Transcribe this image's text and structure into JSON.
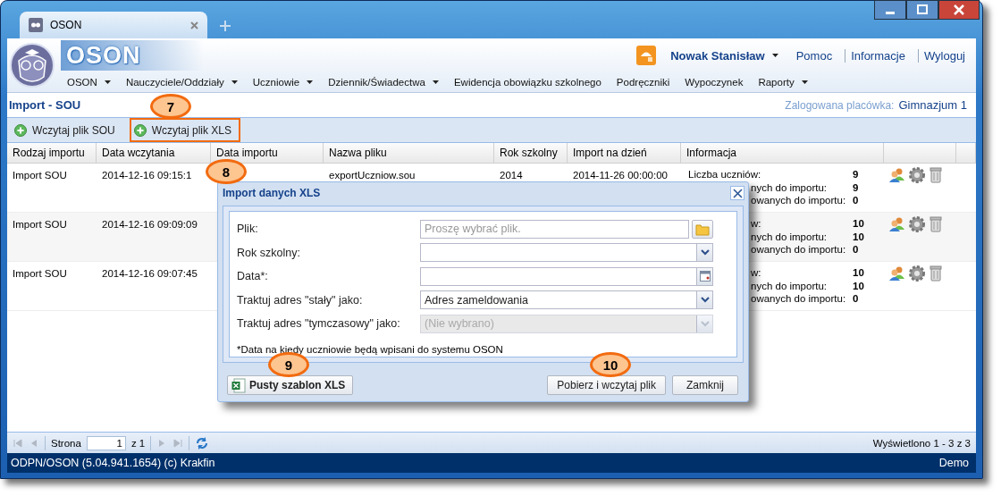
{
  "browser": {
    "tab_title": "OSON"
  },
  "header": {
    "app_name": "OSON",
    "user": "Nowak Stanisław",
    "links": [
      "Pomoc",
      "Informacje",
      "Wyloguj"
    ]
  },
  "menu": [
    {
      "label": "OSON",
      "has_submenu": true
    },
    {
      "label": "Nauczyciele/Oddziały",
      "has_submenu": true
    },
    {
      "label": "Uczniowie",
      "has_submenu": true
    },
    {
      "label": "Dziennik/Świadectwa",
      "has_submenu": true
    },
    {
      "label": "Ewidencja obowiązku szkolnego",
      "has_submenu": false
    },
    {
      "label": "Podręczniki",
      "has_submenu": false
    },
    {
      "label": "Wypoczynek",
      "has_submenu": false
    },
    {
      "label": "Raporty",
      "has_submenu": true
    }
  ],
  "page": {
    "title": "Import - SOU",
    "facility_label": "Zalogowana placówka:",
    "facility": "Gimnazjum 1"
  },
  "toolbar": [
    {
      "label": "Wczytaj plik SOU",
      "highlighted": false
    },
    {
      "label": "Wczytaj plik XLS",
      "highlighted": true
    }
  ],
  "table": {
    "columns": [
      "Rodzaj importu",
      "Data wczytania",
      "Data importu",
      "Nazwa pliku",
      "Rok szkolny",
      "Import na dzień",
      "Informacja"
    ],
    "rows": [
      {
        "type": "Import SOU",
        "loaded": "2014-12-16 09:15:1",
        "file": "exportUczniow.sou",
        "year": "2014",
        "import_date": "2014-11-26 00:00:00",
        "info": [
          {
            "label": "Liczba uczniów:",
            "value": "9",
            "kind": "full"
          },
          {
            "label": "nych do importu:",
            "value": "9",
            "kind": "cut"
          },
          {
            "label": "owanych do importu:",
            "value": "0",
            "kind": "cut"
          }
        ]
      },
      {
        "type": "Import SOU",
        "loaded": "2014-12-16 09:09:09",
        "info": [
          {
            "label": "w:",
            "value": "10",
            "kind": "cut"
          },
          {
            "label": "nych do importu:",
            "value": "10",
            "kind": "cut"
          },
          {
            "label": "owanych do importu:",
            "value": "0",
            "kind": "cut"
          }
        ]
      },
      {
        "type": "Import SOU",
        "loaded": "2014-12-16 09:07:45",
        "info": [
          {
            "label": "w:",
            "value": "10",
            "kind": "cut"
          },
          {
            "label": "nych do importu:",
            "value": "10",
            "kind": "cut"
          },
          {
            "label": "owanych do importu:",
            "value": "0",
            "kind": "cut"
          }
        ]
      }
    ]
  },
  "pager": {
    "page_label": "Strona",
    "page": "1",
    "of": "z 1",
    "summary": "Wyświetlono 1 - 3 z 3"
  },
  "status_bar": {
    "text": "ODPN/OSON (5.04.941.1654) (c) Krakfin",
    "mode": "Demo"
  },
  "dialog": {
    "title": "Import danych XLS",
    "fields": [
      {
        "label": "Plik:",
        "kind": "file",
        "placeholder": "Proszę wybrać plik.",
        "disabled": false
      },
      {
        "label": "Rok szkolny:",
        "kind": "select",
        "disabled": false
      },
      {
        "label": "Data*:",
        "kind": "date",
        "disabled": false
      },
      {
        "label": "Traktuj adres \"stały\" jako:",
        "kind": "select",
        "value": "Adres zameldowania",
        "disabled": false
      },
      {
        "label": "Traktuj adres \"tymczasowy\" jako:",
        "kind": "select",
        "value": "(Nie wybrano)",
        "disabled": true
      }
    ],
    "note": "*Data na kiedy uczniowie będą wpisani do systemu OSON",
    "buttons": [
      {
        "label": "Pusty szablon XLS",
        "kind": "template"
      },
      {
        "label": "Pobierz i wczytaj plik",
        "kind": "action"
      },
      {
        "label": "Zamknij",
        "kind": "action"
      }
    ]
  },
  "callouts": [
    {
      "label": "7"
    },
    {
      "label": "8"
    },
    {
      "label": "9"
    },
    {
      "label": "10"
    }
  ]
}
